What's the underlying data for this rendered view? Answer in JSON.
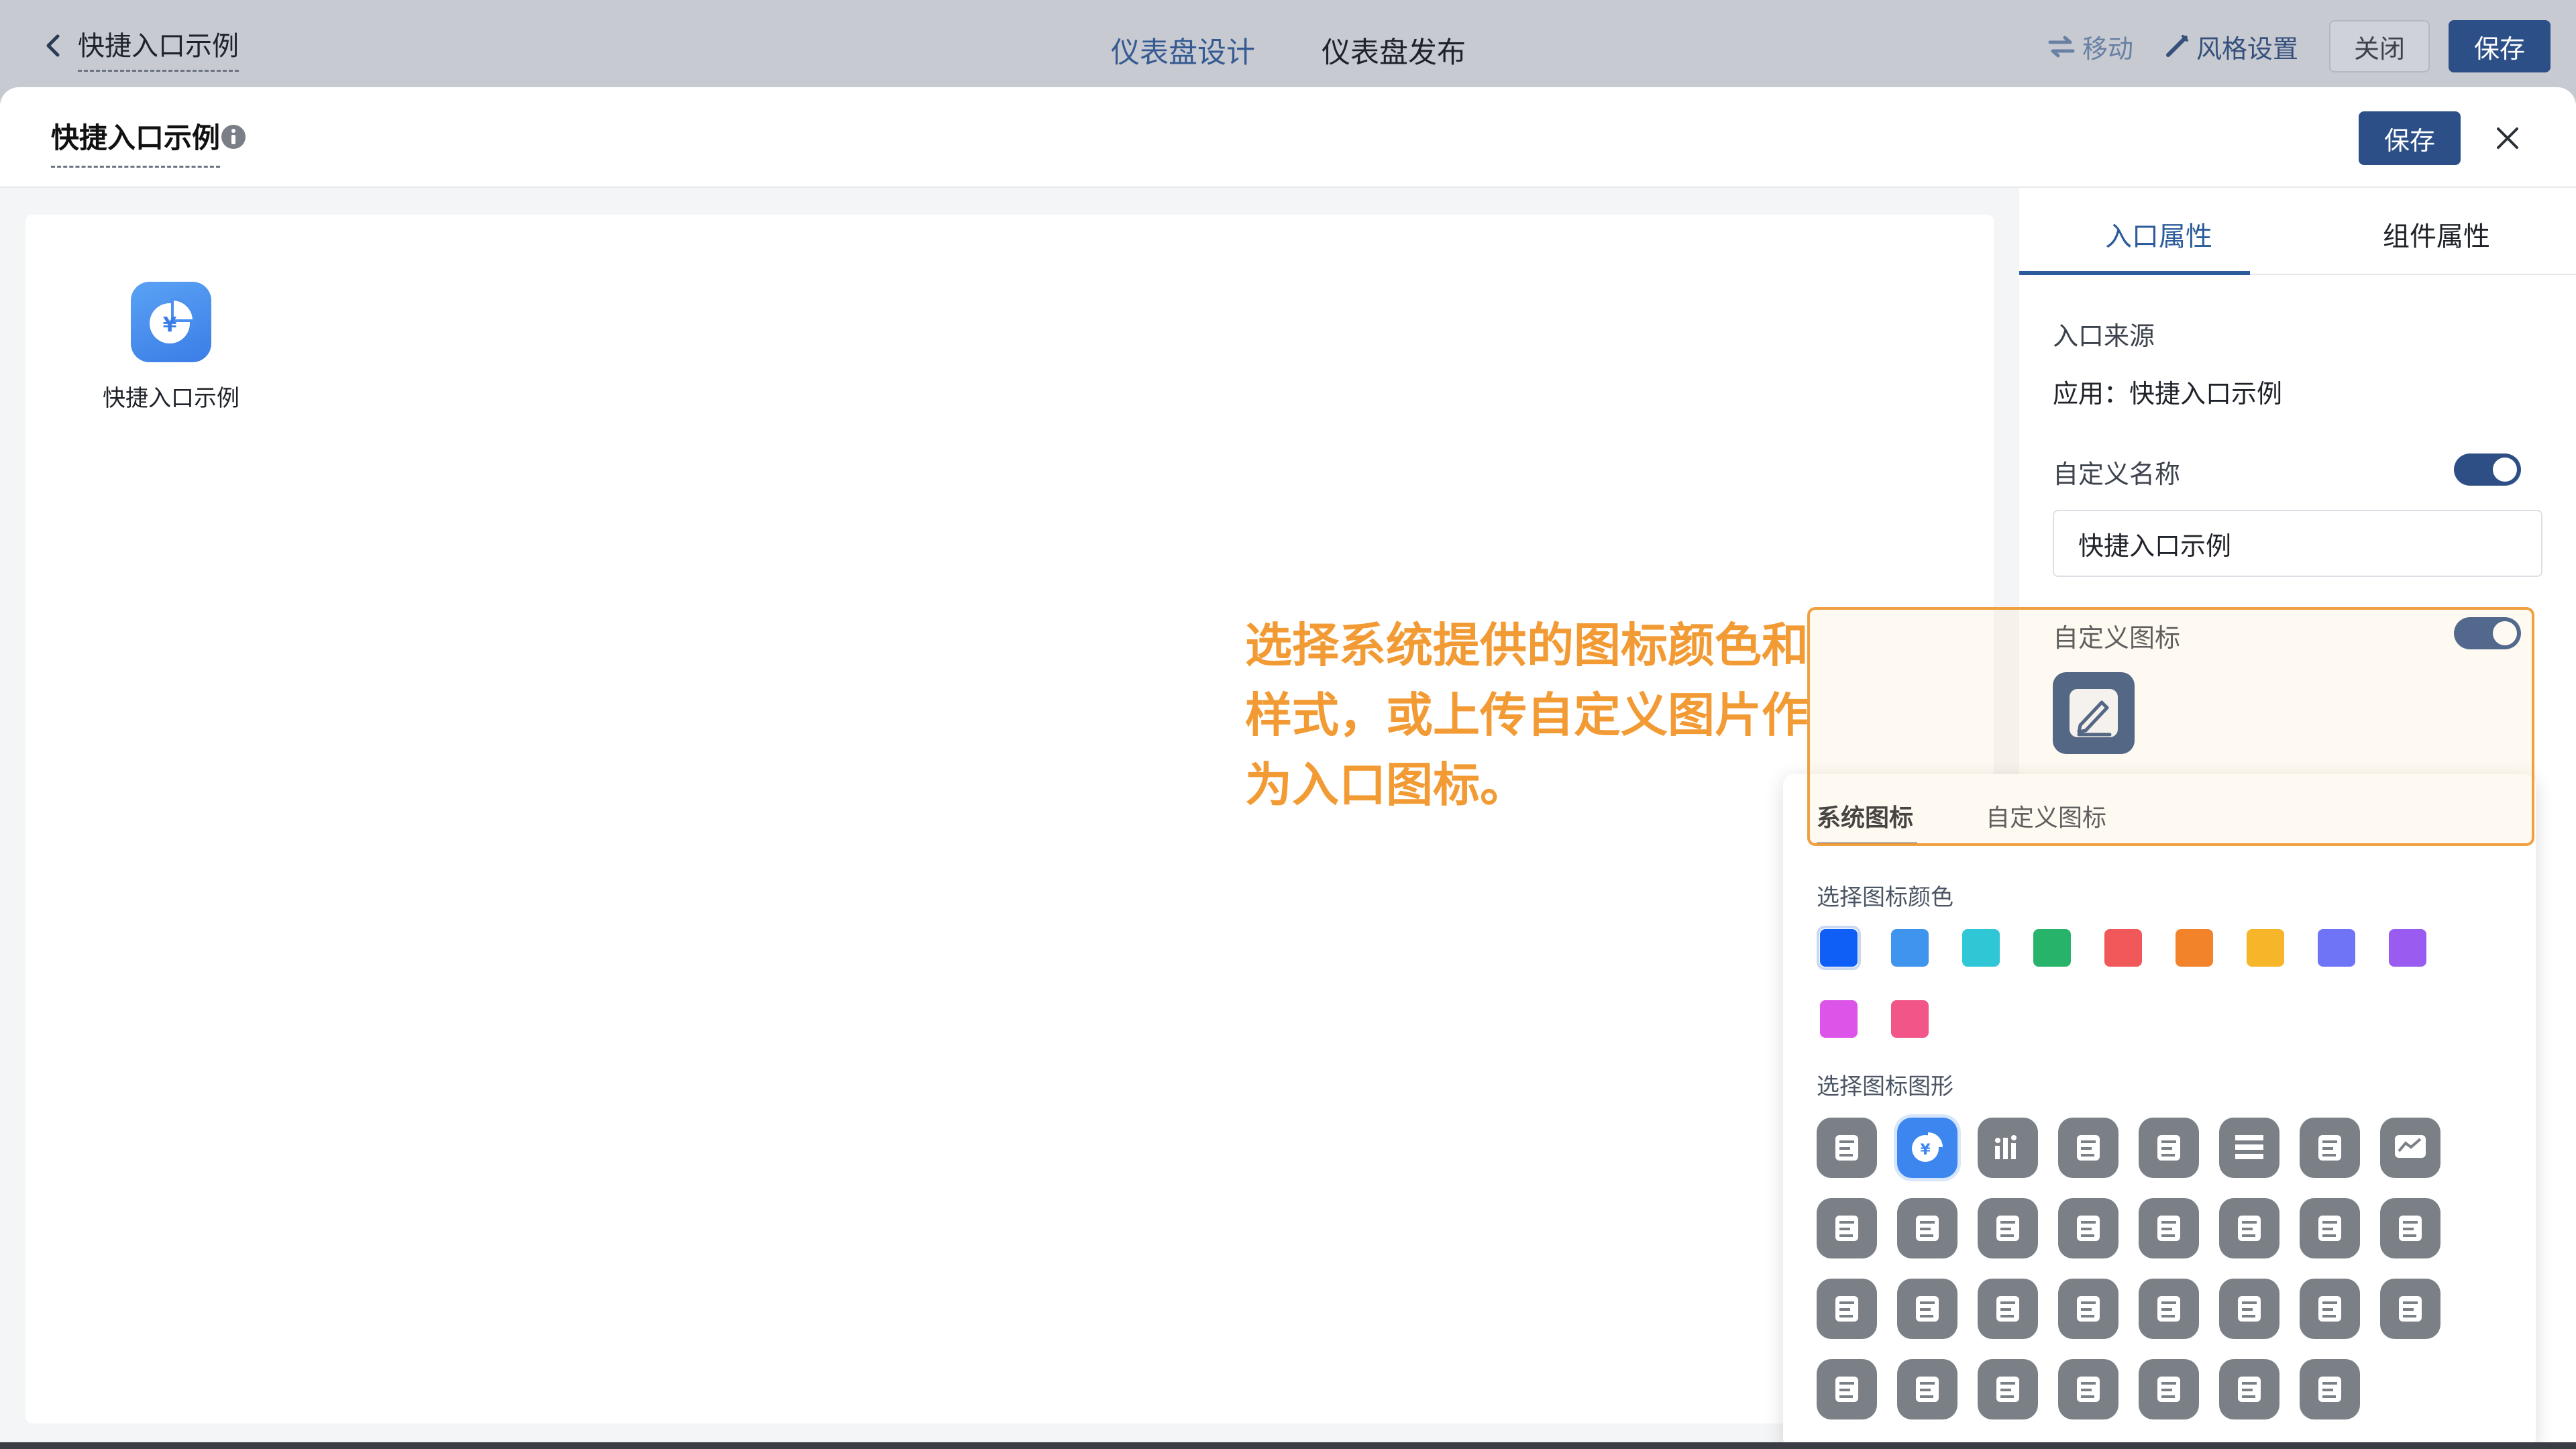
{
  "topbar": {
    "app_title": "快捷入口示例",
    "tabs": [
      "仪表盘设计",
      "仪表盘发布"
    ],
    "move_label": "移动",
    "style_label": "风格设置",
    "close_label": "关闭",
    "save_label": "保存"
  },
  "modal": {
    "title": "快捷入口示例",
    "save_label": "保存",
    "shortcut": {
      "label": "快捷入口示例",
      "icon": "pie-chart-yen-icon",
      "color": "#4a90ee"
    }
  },
  "panel": {
    "tabs": [
      "入口属性",
      "组件属性"
    ],
    "source_label": "入口来源",
    "source_value": "应用：快捷入口示例",
    "custom_name_label": "自定义名称",
    "custom_name_enabled": true,
    "custom_name_value": "快捷入口示例",
    "custom_icon_label": "自定义图标",
    "custom_icon_enabled": true,
    "current_icon": "edit-pen-icon"
  },
  "icon_picker": {
    "tabs": [
      "系统图标",
      "自定义图标"
    ],
    "color_label": "选择图标颜色",
    "colors": [
      "#0f5ef5",
      "#3f94ee",
      "#2fc7d6",
      "#27b36a",
      "#f0585a",
      "#f2832a",
      "#f7b52a",
      "#6f73f5",
      "#9a5cf0",
      "#dd55e8",
      "#f25588"
    ],
    "selected_color": "#0f5ef5",
    "shape_label": "选择图标图形",
    "shapes": [
      "building-book-icon",
      "pie-chart-yen-icon",
      "bar-chart-icon",
      "building-icon",
      "document-chart-icon",
      "list-table-icon",
      "calendar-check-icon",
      "line-chart-icon",
      "recycle-icon",
      "wallet-icon",
      "newspaper-icon",
      "receipt-icon",
      "inbox-icon",
      "office-building-icon",
      "wave-icon",
      "id-card-icon",
      "browser-cursor-icon",
      "clipboard-chart-icon",
      "clipboard-list-icon",
      "team-icon",
      "press-icon",
      "mail-icon",
      "home-icon",
      "medical-cross-icon",
      "hand-yen-icon",
      "discount-tag-icon",
      "cube-stats-icon",
      "hr-icon",
      "enterprise-icon",
      "yen-door-icon",
      "invoice-icon"
    ],
    "selected_shape": "pie-chart-yen-icon"
  },
  "annotation": {
    "text": "选择系统提供的图标颜色和样式，或上传自定义图片作为入口图标。",
    "color": "#f29b35"
  }
}
